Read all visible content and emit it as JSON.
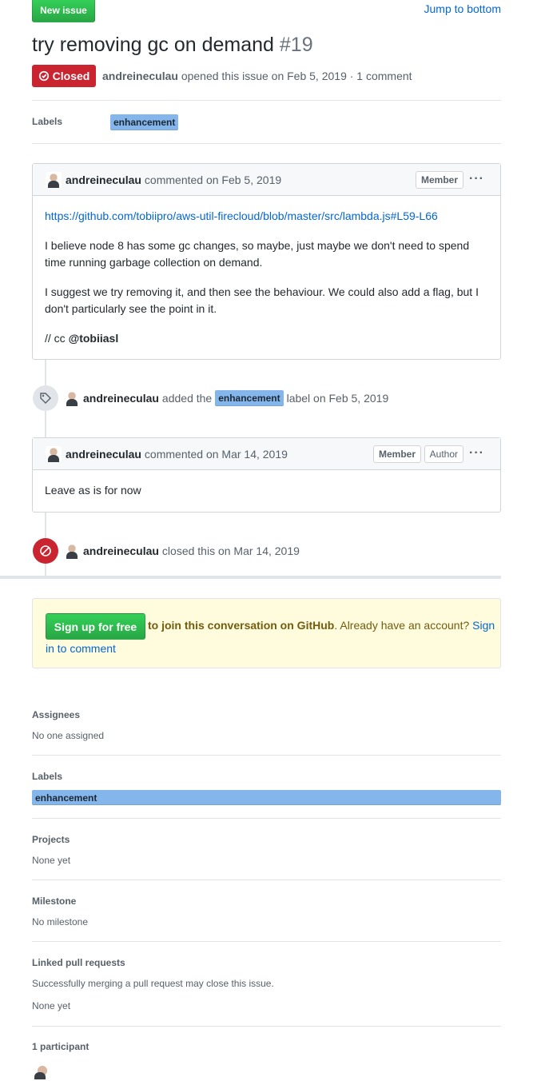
{
  "header": {
    "new_issue": "New issue",
    "jump": "Jump to bottom"
  },
  "issue": {
    "title": "try removing gc on demand",
    "number": "#19",
    "state": "Closed",
    "author": "andreineculau",
    "meta_rest": "opened this issue on Feb 5, 2019 · 1 comment"
  },
  "labels_row": {
    "label": "Labels",
    "tag": "enhancement"
  },
  "comment1": {
    "author": "andreineculau",
    "action": "commented on Feb 5, 2019",
    "badge": "Member",
    "link": "https://github.com/tobiipro/aws-util-firecloud/blob/master/src/lambda.js#L59-L66",
    "p1": "I believe node 8 has some gc changes, so maybe, just maybe we don't need to spend time running garbage collection on demand.",
    "p2": "I suggest we try removing it, and then see the behaviour. We could also add a flag, but I don't particularly see the point in it.",
    "cc_prefix": "// cc",
    "cc_user": "@tobiiasl"
  },
  "event_label": {
    "author": "andreineculau",
    "pre": "added the",
    "tag": "enhancement",
    "post": "label on Feb 5, 2019"
  },
  "comment2": {
    "author": "andreineculau",
    "action": "commented on Mar 14, 2019",
    "badge_member": "Member",
    "badge_author": "Author",
    "text": "Leave as is for now"
  },
  "event_close": {
    "author": "andreineculau",
    "text": "closed this on Mar 14, 2019"
  },
  "signup": {
    "button": "Sign up for free",
    "bold": "to join this conversation on GitHub",
    "rest": ". Already have an account?",
    "link1": "Sign",
    "link2": "in to comment"
  },
  "sidebar": {
    "assignees_h": "Assignees",
    "assignees_v": "No one assigned",
    "labels_h": "Labels",
    "labels_v": "enhancement",
    "projects_h": "Projects",
    "projects_v": "None yet",
    "milestone_h": "Milestone",
    "milestone_v": "No milestone",
    "linked_h": "Linked pull requests",
    "linked_desc": "Successfully merging a pull request may close this issue.",
    "linked_v": "None yet",
    "participants_h": "1 participant"
  },
  "colors": {
    "closed": "#cb2431",
    "green": "#28a745",
    "label": "#84b6eb",
    "link": "#0366d6"
  }
}
